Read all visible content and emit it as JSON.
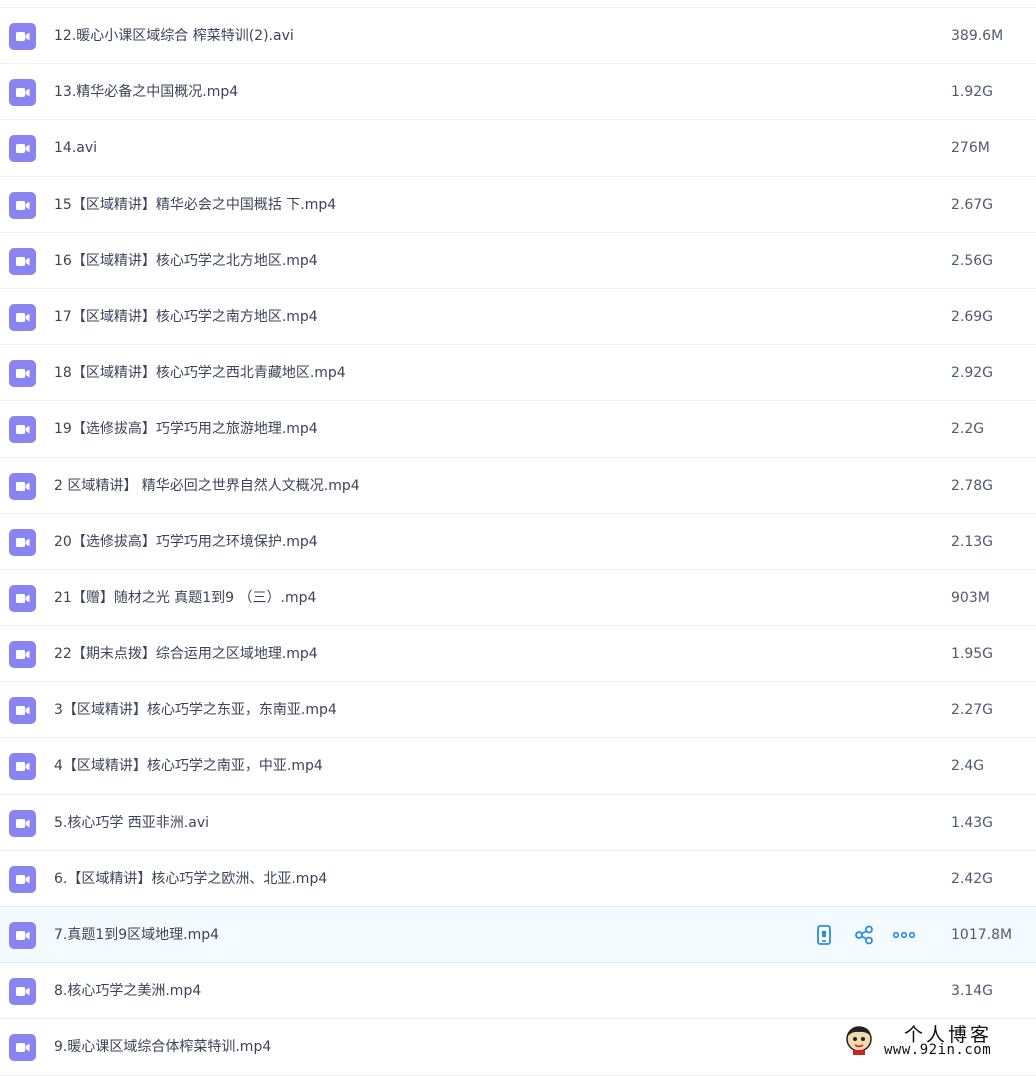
{
  "files": [
    {
      "name": "12.暖心小课区域综合 榨菜特训(2).avi",
      "size": "389.6M",
      "icon": "video-file-icon"
    },
    {
      "name": "13.精华必备之中国概况.mp4",
      "size": "1.92G",
      "icon": "video-file-icon"
    },
    {
      "name": "14.avi",
      "size": "276M",
      "icon": "video-file-icon"
    },
    {
      "name": "15【区域精讲】精华必会之中国概括 下.mp4",
      "size": "2.67G",
      "icon": "video-file-icon"
    },
    {
      "name": "16【区域精讲】核心巧学之北方地区.mp4",
      "size": "2.56G",
      "icon": "video-file-icon"
    },
    {
      "name": "17【区域精讲】核心巧学之南方地区.mp4",
      "size": "2.69G",
      "icon": "video-file-icon"
    },
    {
      "name": "18【区域精讲】核心巧学之西北青藏地区.mp4",
      "size": "2.92G",
      "icon": "video-file-icon"
    },
    {
      "name": "19【选修拔高】巧学巧用之旅游地理.mp4",
      "size": "2.2G",
      "icon": "video-file-icon"
    },
    {
      "name": "2 区域精讲】 精华必回之世界自然人文概况.mp4",
      "size": "2.78G",
      "icon": "video-file-icon"
    },
    {
      "name": "20【选修拔高】巧学巧用之环境保护.mp4",
      "size": "2.13G",
      "icon": "video-file-icon"
    },
    {
      "name": "21【赠】随材之光 真题1到9 （三）.mp4",
      "size": "903M",
      "icon": "video-file-icon"
    },
    {
      "name": "22【期末点拨】综合运用之区域地理.mp4",
      "size": "1.95G",
      "icon": "video-file-icon"
    },
    {
      "name": "3【区域精讲】核心巧学之东亚，东南亚.mp4",
      "size": "2.27G",
      "icon": "video-file-icon"
    },
    {
      "name": "4【区域精讲】核心巧学之南亚，中亚.mp4",
      "size": "2.4G",
      "icon": "video-file-icon"
    },
    {
      "name": "5.核心巧学 西亚非洲.avi",
      "size": "1.43G",
      "icon": "video-file-icon"
    },
    {
      "name": "6.【区域精讲】核心巧学之欧洲、北亚.mp4",
      "size": "2.42G",
      "icon": "video-file-icon"
    },
    {
      "name": "7.真题1到9区域地理.mp4",
      "size": "1017.8M",
      "icon": "video-file-icon"
    },
    {
      "name": "8.核心巧学之美洲.mp4",
      "size": "3.14G",
      "icon": "video-file-icon"
    },
    {
      "name": "9.暖心课区域综合体榨菜特训.mp4",
      "size": "",
      "icon": "video-file-icon"
    }
  ],
  "hover_row_index": 16,
  "row_actions": [
    {
      "name": "mobile-view-icon",
      "label": ""
    },
    {
      "name": "share-icon",
      "label": ""
    },
    {
      "name": "more-options-icon",
      "label": ""
    }
  ],
  "watermark": {
    "title": "个人博客",
    "url": "www.92in.com"
  },
  "colors": {
    "icon_bg": "#8a84f2",
    "action_blue": "#2b8ce0",
    "hover_bg": "#f4fbff",
    "divider": "#eef0f4"
  }
}
